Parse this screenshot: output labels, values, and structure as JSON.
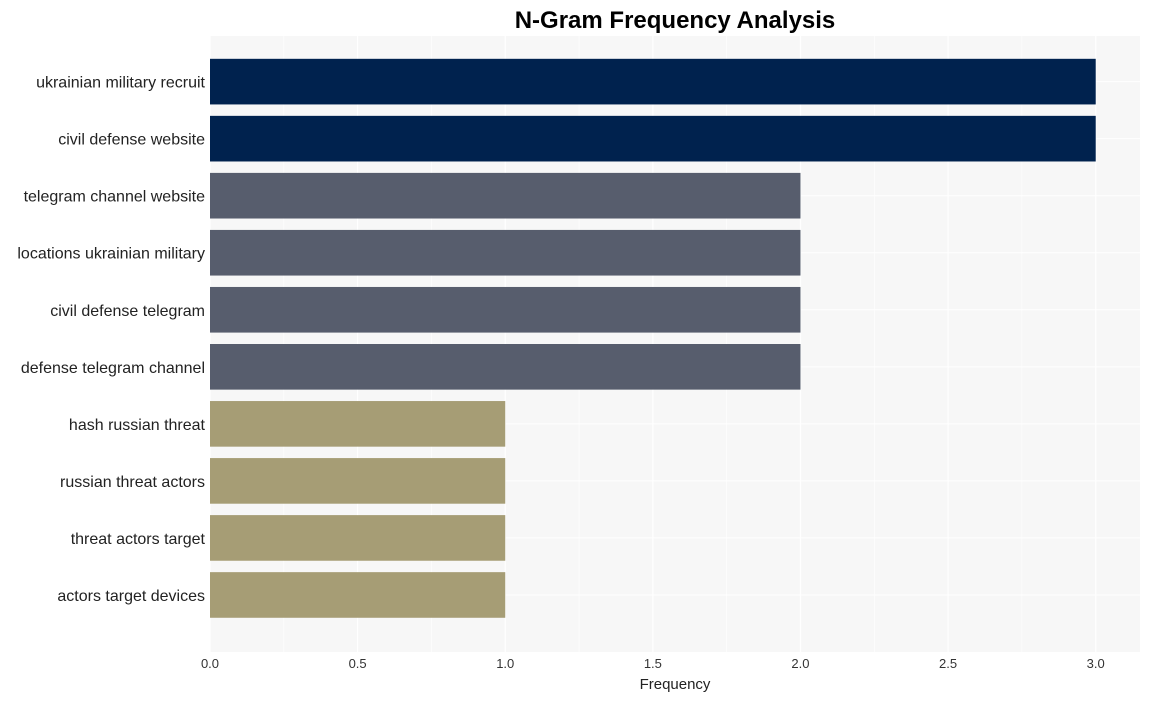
{
  "chart_data": {
    "type": "bar",
    "orientation": "horizontal",
    "title": "N-Gram Frequency Analysis",
    "xlabel": "Frequency",
    "ylabel": "",
    "xlim": [
      0,
      3.15
    ],
    "xticks": [
      0.0,
      0.5,
      1.0,
      1.5,
      2.0,
      2.5,
      3.0
    ],
    "xtick_labels": [
      "0.0",
      "0.5",
      "1.0",
      "1.5",
      "2.0",
      "2.5",
      "3.0"
    ],
    "grid": true,
    "legend": "none",
    "categories": [
      "ukrainian military recruit",
      "civil defense website",
      "telegram channel website",
      "locations ukrainian military",
      "civil defense telegram",
      "defense telegram channel",
      "hash russian threat",
      "russian threat actors",
      "threat actors target",
      "actors target devices"
    ],
    "values": [
      3,
      3,
      2,
      2,
      2,
      2,
      1,
      1,
      1,
      1
    ],
    "colors": [
      "#00224e",
      "#00224e",
      "#575d6d",
      "#575d6d",
      "#575d6d",
      "#575d6d",
      "#a69d75",
      "#a69d75",
      "#a69d75",
      "#a69d75"
    ],
    "plot_background": "#f7f7f7",
    "grid_color": "#ffffff"
  }
}
